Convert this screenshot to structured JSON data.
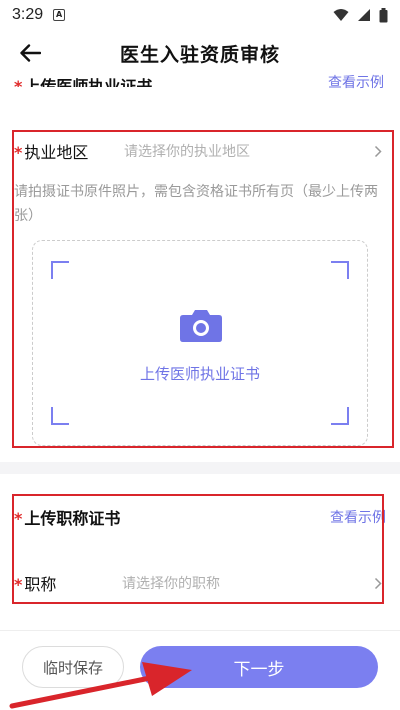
{
  "status_bar": {
    "time": "3:29",
    "app_icon": "A"
  },
  "header": {
    "title": "医生入驻资质审核"
  },
  "license_section": {
    "partial_title": "上传医师执业证书",
    "view_example": "查看示例"
  },
  "region_field": {
    "required_mark": "*",
    "label": "执业地区",
    "placeholder": "请选择你的执业地区"
  },
  "photo_hint": "请拍摄证书原件照片，需包含资格证书所有页（最少上传两张）",
  "upload": {
    "label": "上传医师执业证书"
  },
  "title_cert_section": {
    "required_mark": "*",
    "title": "上传职称证书",
    "view_example": "查看示例"
  },
  "title_field": {
    "required_mark": "*",
    "label": "职称",
    "placeholder": "请选择你的职称"
  },
  "footer": {
    "save_label": "临时保存",
    "next_label": "下一步"
  },
  "colors": {
    "accent": "#7b7ff0",
    "link": "#6f74e6",
    "required": "#e02b2b",
    "annotation": "#d9252b"
  }
}
